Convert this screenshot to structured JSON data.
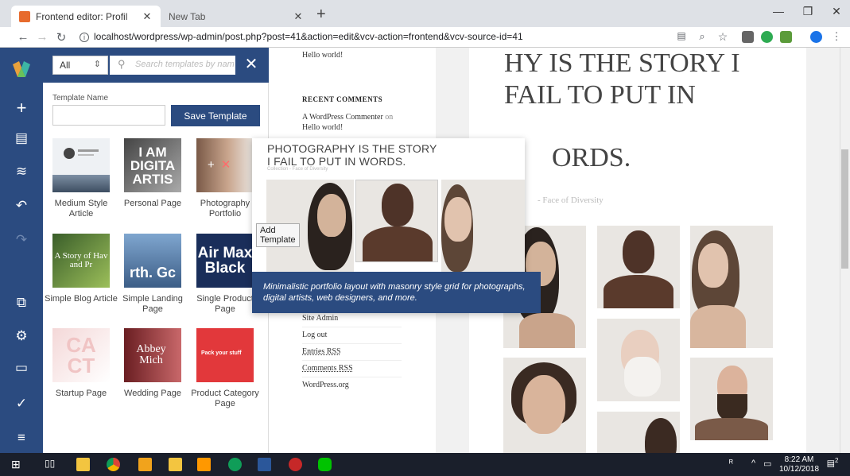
{
  "browser": {
    "tabs": [
      {
        "title": "Frontend editor: Profil"
      },
      {
        "title": "New Tab"
      }
    ],
    "url": "localhost/wordpress/wp-admin/post.php?post=41&action=edit&vcv-action=frontend&vcv-source-id=41"
  },
  "panel": {
    "filter_value": "All",
    "search_placeholder": "Search templates by nam",
    "template_name_label": "Template Name",
    "save_button": "Save Template",
    "tooltip": "Add Template",
    "templates": [
      {
        "label": "Medium Style Article",
        "thumb": ""
      },
      {
        "label": "Personal Page",
        "thumb": "I AM DIGITA ARTIS"
      },
      {
        "label": "Photography Portfolio",
        "thumb": ""
      },
      {
        "label": "Simple Blog Article",
        "thumb": "A Story of Hav and Pr"
      },
      {
        "label": "Simple Landing Page",
        "thumb": "rth. Gc"
      },
      {
        "label": "Single Product Page",
        "thumb": "Air Max Black"
      },
      {
        "label": "Startup Page",
        "thumb": "CA CT"
      },
      {
        "label": "Wedding Page",
        "thumb": "Abbey Mich"
      },
      {
        "label": "Product Category Page",
        "thumb": "Pack your stuff"
      }
    ]
  },
  "sidebar": {
    "hello_world": "Hello world!",
    "recent_comments_heading": "RECENT COMMENTS",
    "comment_author": "A WordPress Commenter",
    "comment_on": "on",
    "comment_post": "Hello world!",
    "meta_links": [
      "Site Admin",
      "Log out",
      "Entries RSS",
      "Comments RSS",
      "WordPress.org"
    ]
  },
  "main": {
    "title": "HY IS THE STORY I FAIL TO PUT IN",
    "title_end": "ORDS.",
    "subtitle": "- Face of Diversity"
  },
  "preview": {
    "title": "PHOTOGRAPHY IS THE STORY I FAIL TO PUT IN WORDS.",
    "subtitle": "Collection - Face of Diversity",
    "description": "Minimalistic portfolio layout with masonry style grid for photographs, digital artists, web designers, and more."
  },
  "taskbar": {
    "time": "8:22 AM",
    "date": "10/12/2018",
    "notifications": "2"
  },
  "colors": {
    "brand": "#2b4b80",
    "delete": "#ff6b6b"
  }
}
